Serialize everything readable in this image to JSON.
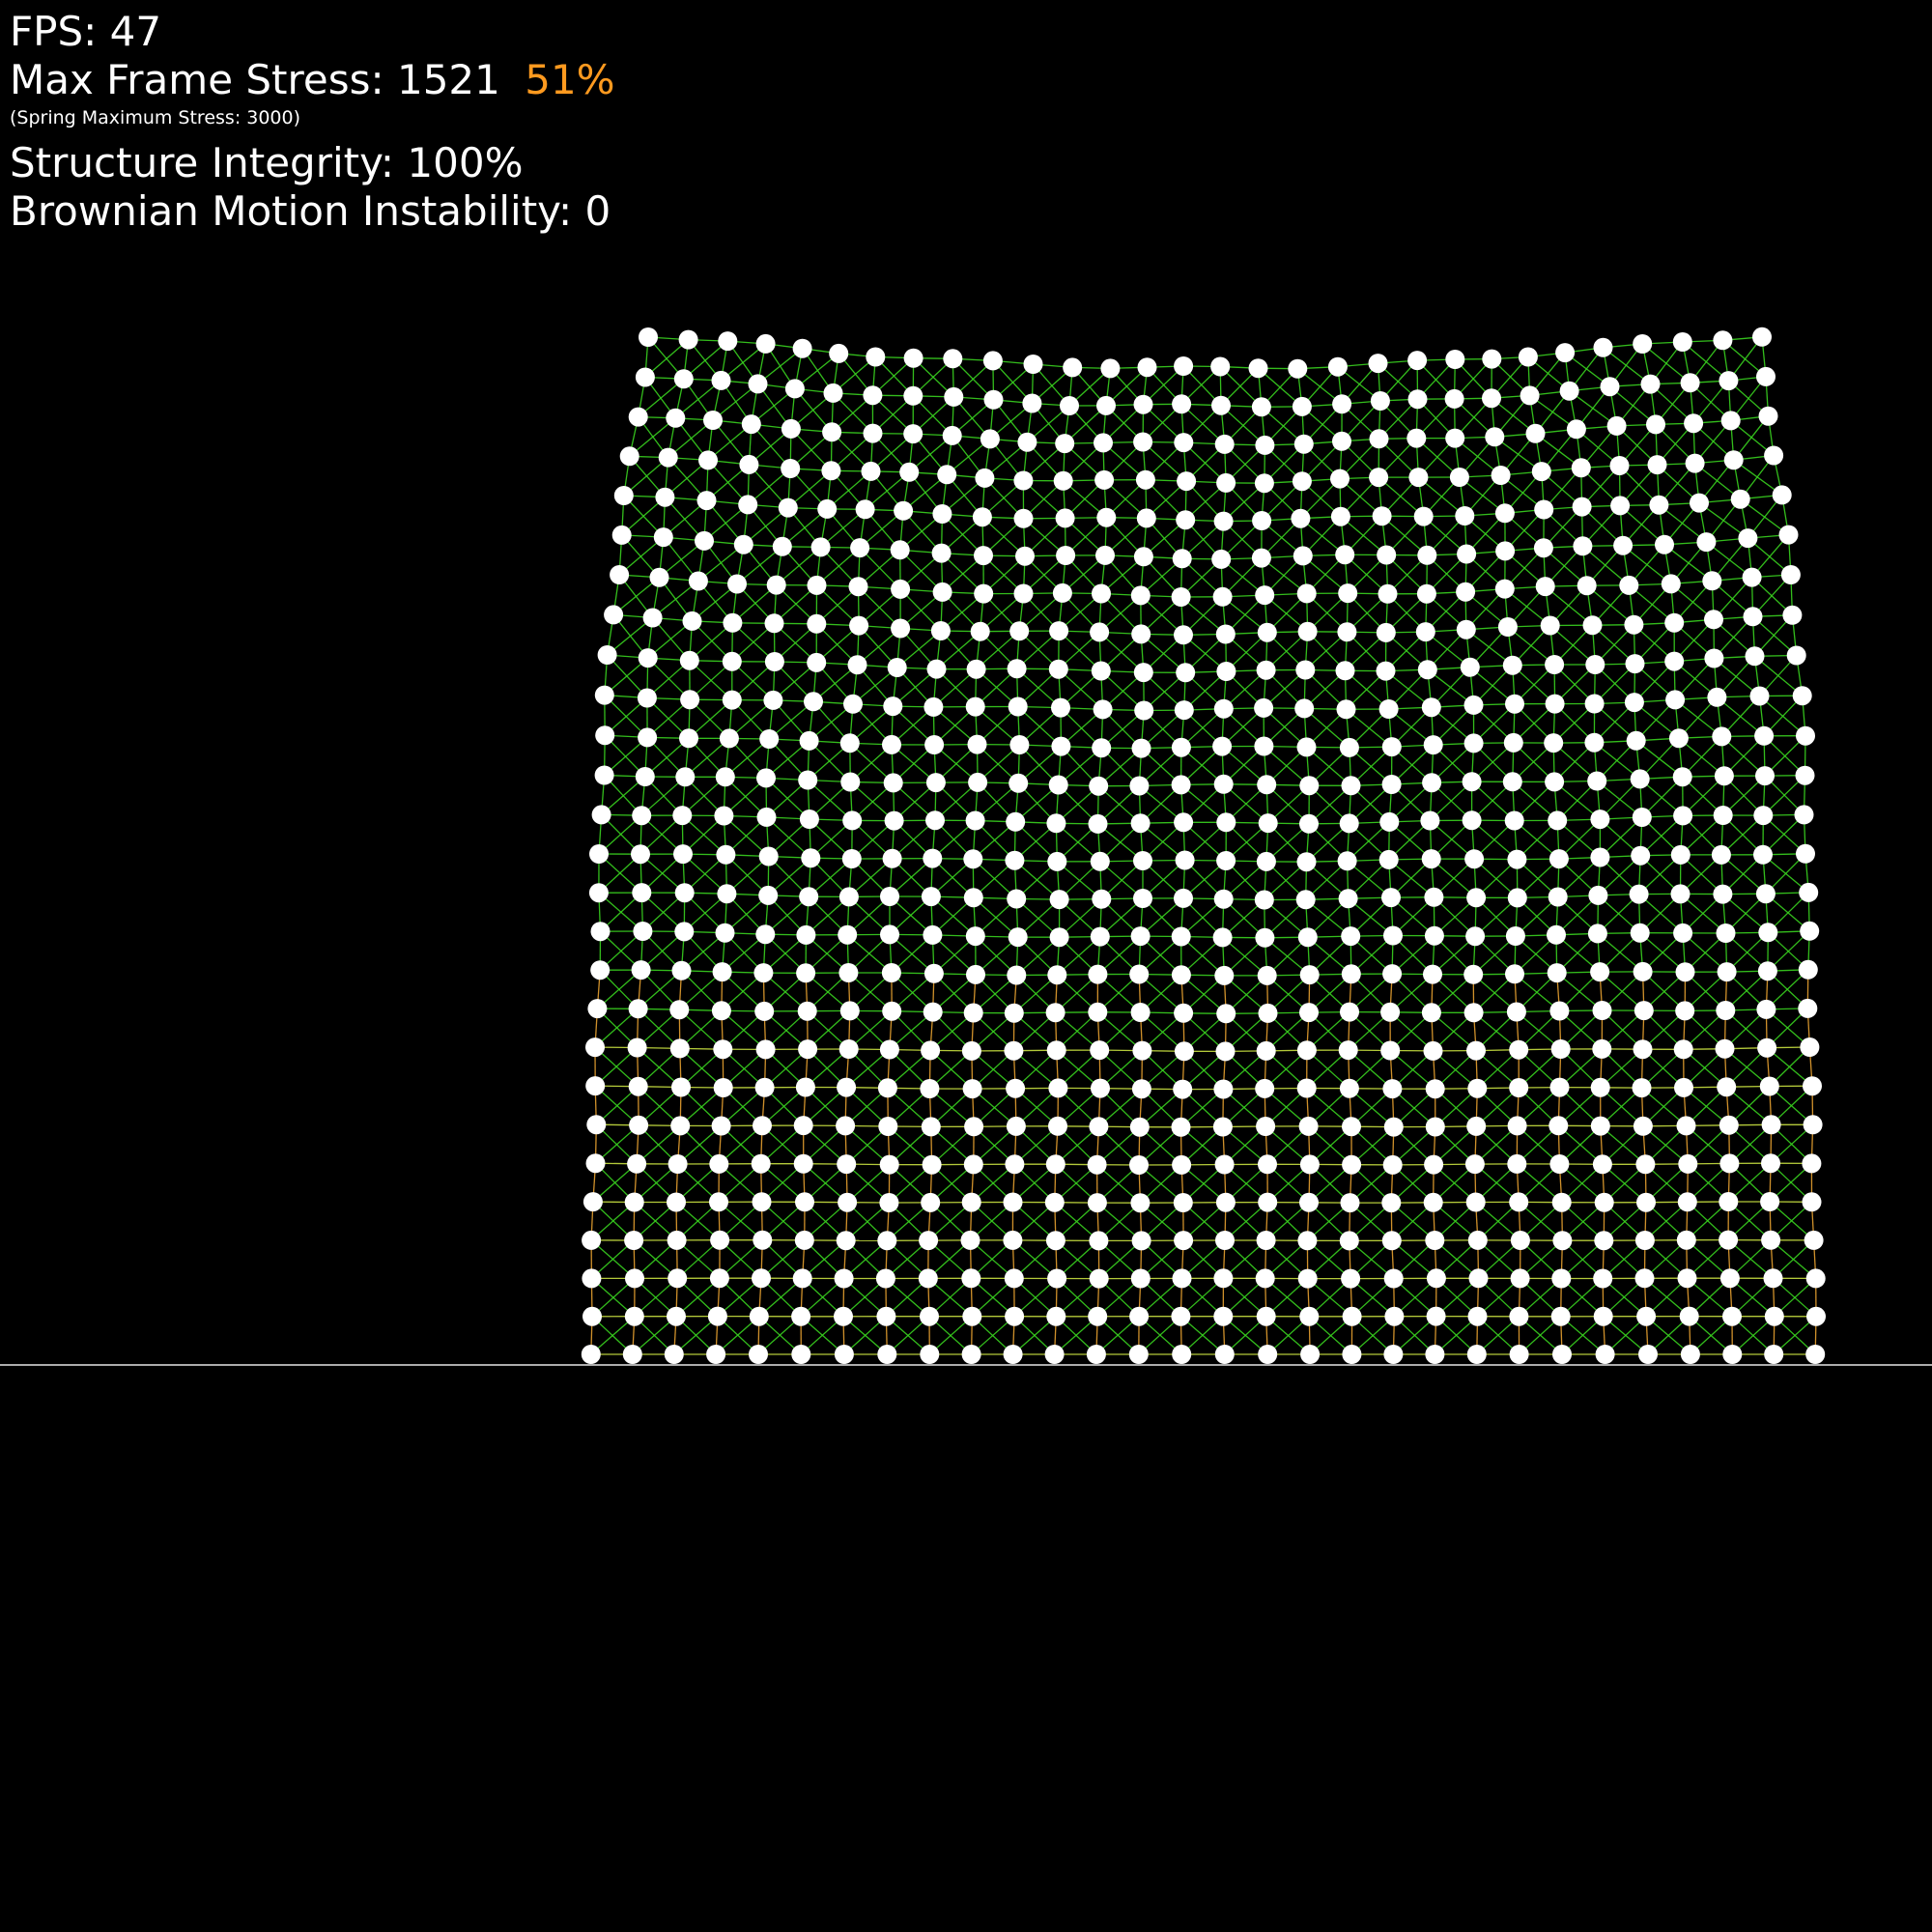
{
  "hud": {
    "fps_label": "FPS:",
    "fps_value": "47",
    "stress_label": "Max Frame Stress:",
    "stress_value": "1521",
    "stress_percent": "51%",
    "spring_max_note": "(Spring Maximum Stress: 3000)",
    "integrity_label": "Structure Integrity:",
    "integrity_value": "100%",
    "brownian_label": "Brownian Motion Instability:",
    "brownian_value": "0"
  },
  "simulation": {
    "grid_columns": 30,
    "grid_rows": 27,
    "stress_fraction": 0.51,
    "integrity_fraction": 1.0
  },
  "colors": {
    "background": "#000000",
    "hud_text": "#ffffff",
    "stress_percent": "#ff9a1f",
    "node": "#ffffff",
    "spring_low_stress": "#39d21f",
    "spring_mid_stress": "#c8e040",
    "spring_high_stress": "#e6a030",
    "ground_line": "#e6e6e6"
  }
}
